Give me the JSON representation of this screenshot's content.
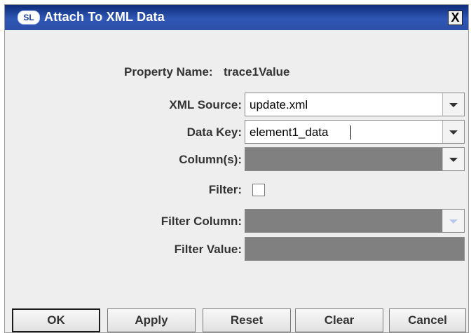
{
  "dialog": {
    "title": "Attach To XML Data",
    "app_icon_text": "SL",
    "close_label": "X"
  },
  "form": {
    "property_name_label": "Property Name:",
    "property_name_value": "trace1Value",
    "xml_source_label": "XML Source:",
    "xml_source_value": "update.xml",
    "data_key_label": "Data Key:",
    "data_key_value": "element1_data",
    "columns_label": "Column(s):",
    "filter_label": "Filter:",
    "filter_checked": false,
    "filter_column_label": "Filter Column:",
    "filter_value_label": "Filter Value:"
  },
  "buttons": {
    "ok": "OK",
    "apply": "Apply",
    "reset": "Reset",
    "clear": "Clear",
    "cancel": "Cancel"
  }
}
